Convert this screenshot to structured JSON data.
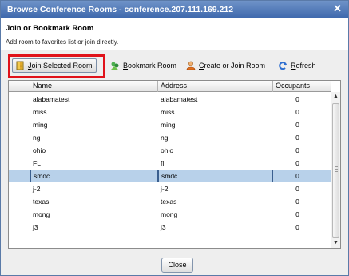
{
  "window": {
    "title": "Browse Conference Rooms - conference.207.111.169.212",
    "close_glyph": "✕"
  },
  "header": {
    "title": "Join or Bookmark Room",
    "subtitle": "Add room to favorites list or join directly."
  },
  "toolbar": {
    "join_label": "Join Selected Room",
    "bookmark_label": "Bookmark Room",
    "create_label": "Create or Join Room",
    "refresh_label": "Refresh"
  },
  "table": {
    "columns": [
      "Name",
      "Address",
      "Occupants"
    ],
    "rows": [
      {
        "name": "alabamatest",
        "address": "alabamatest",
        "occupants": "0"
      },
      {
        "name": "miss",
        "address": "miss",
        "occupants": "0"
      },
      {
        "name": "ming",
        "address": "ming",
        "occupants": "0"
      },
      {
        "name": "ng",
        "address": "ng",
        "occupants": "0"
      },
      {
        "name": "ohio",
        "address": "ohio",
        "occupants": "0"
      },
      {
        "name": "FL",
        "address": "fl",
        "occupants": "0"
      },
      {
        "name": "smdc",
        "address": "smdc",
        "occupants": "0"
      },
      {
        "name": "j-2",
        "address": "j-2",
        "occupants": "0"
      },
      {
        "name": "texas",
        "address": "texas",
        "occupants": "0"
      },
      {
        "name": "mong",
        "address": "mong",
        "occupants": "0"
      },
      {
        "name": "j3",
        "address": "j3",
        "occupants": "0"
      }
    ],
    "selected_index": 6
  },
  "footer": {
    "close_label": "Close"
  }
}
